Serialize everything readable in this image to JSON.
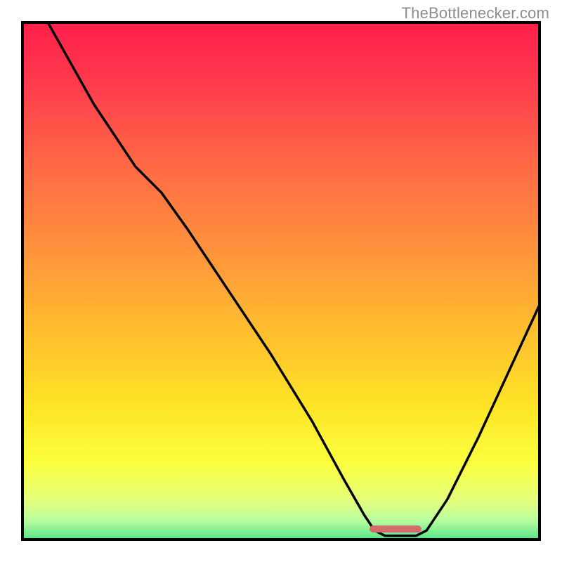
{
  "watermark": "TheBottlenecker.com",
  "chart_data": {
    "type": "line",
    "title": "",
    "xlabel": "",
    "ylabel": "",
    "xlim": [
      0,
      100
    ],
    "ylim": [
      0,
      100
    ],
    "gradient_stops": [
      {
        "offset": 0.0,
        "color": "#ff1f4a"
      },
      {
        "offset": 0.12,
        "color": "#ff3b4d"
      },
      {
        "offset": 0.28,
        "color": "#ff6a45"
      },
      {
        "offset": 0.44,
        "color": "#ff933c"
      },
      {
        "offset": 0.6,
        "color": "#ffbf2e"
      },
      {
        "offset": 0.74,
        "color": "#ffe426"
      },
      {
        "offset": 0.85,
        "color": "#fbff3f"
      },
      {
        "offset": 0.92,
        "color": "#e6ff7a"
      },
      {
        "offset": 0.96,
        "color": "#b8ffa0"
      },
      {
        "offset": 1.0,
        "color": "#50e084"
      }
    ],
    "series": [
      {
        "name": "curve",
        "points": [
          {
            "x": 5.0,
            "y": 100.0
          },
          {
            "x": 14.0,
            "y": 84.0
          },
          {
            "x": 22.0,
            "y": 72.0
          },
          {
            "x": 27.0,
            "y": 67.0
          },
          {
            "x": 32.0,
            "y": 60.0
          },
          {
            "x": 40.0,
            "y": 48.0
          },
          {
            "x": 48.0,
            "y": 36.0
          },
          {
            "x": 56.0,
            "y": 23.0
          },
          {
            "x": 62.0,
            "y": 12.0
          },
          {
            "x": 66.0,
            "y": 5.0
          },
          {
            "x": 68.0,
            "y": 2.0
          },
          {
            "x": 70.0,
            "y": 1.0
          },
          {
            "x": 76.0,
            "y": 1.0
          },
          {
            "x": 78.0,
            "y": 2.0
          },
          {
            "x": 82.0,
            "y": 8.0
          },
          {
            "x": 88.0,
            "y": 20.0
          },
          {
            "x": 94.0,
            "y": 33.0
          },
          {
            "x": 100.0,
            "y": 46.0
          }
        ]
      }
    ],
    "marker": {
      "x_start": 67.0,
      "x_end": 77.0,
      "y": 2.3
    }
  }
}
